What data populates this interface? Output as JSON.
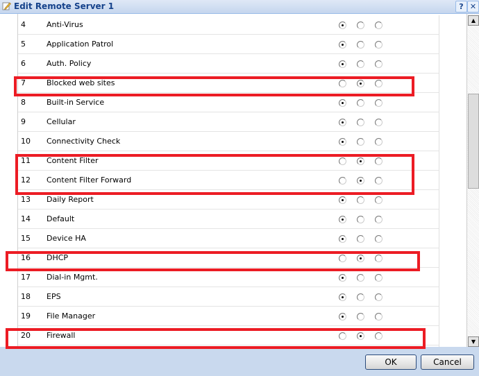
{
  "window": {
    "title": "Edit Remote Server 1",
    "help_label": "?",
    "close_label": "✕"
  },
  "rows": [
    {
      "num": "4",
      "name": "Anti-Virus",
      "selected": 0
    },
    {
      "num": "5",
      "name": "Application Patrol",
      "selected": 0
    },
    {
      "num": "6",
      "name": "Auth. Policy",
      "selected": 0
    },
    {
      "num": "7",
      "name": "Blocked web sites",
      "selected": 1
    },
    {
      "num": "8",
      "name": "Built-in Service",
      "selected": 0
    },
    {
      "num": "9",
      "name": "Cellular",
      "selected": 0
    },
    {
      "num": "10",
      "name": "Connectivity Check",
      "selected": 0
    },
    {
      "num": "11",
      "name": "Content Filter",
      "selected": 1
    },
    {
      "num": "12",
      "name": "Content Filter Forward",
      "selected": 1
    },
    {
      "num": "13",
      "name": "Daily Report",
      "selected": 0
    },
    {
      "num": "14",
      "name": "Default",
      "selected": 0
    },
    {
      "num": "15",
      "name": "Device HA",
      "selected": 0
    },
    {
      "num": "16",
      "name": "DHCP",
      "selected": 1
    },
    {
      "num": "17",
      "name": "Dial-in Mgmt.",
      "selected": 0
    },
    {
      "num": "18",
      "name": "EPS",
      "selected": 0
    },
    {
      "num": "19",
      "name": "File Manager",
      "selected": 0
    },
    {
      "num": "20",
      "name": "Firewall",
      "selected": 1
    }
  ],
  "highlight_color": "#ec1c24",
  "footer": {
    "ok_label": "OK",
    "cancel_label": "Cancel"
  }
}
